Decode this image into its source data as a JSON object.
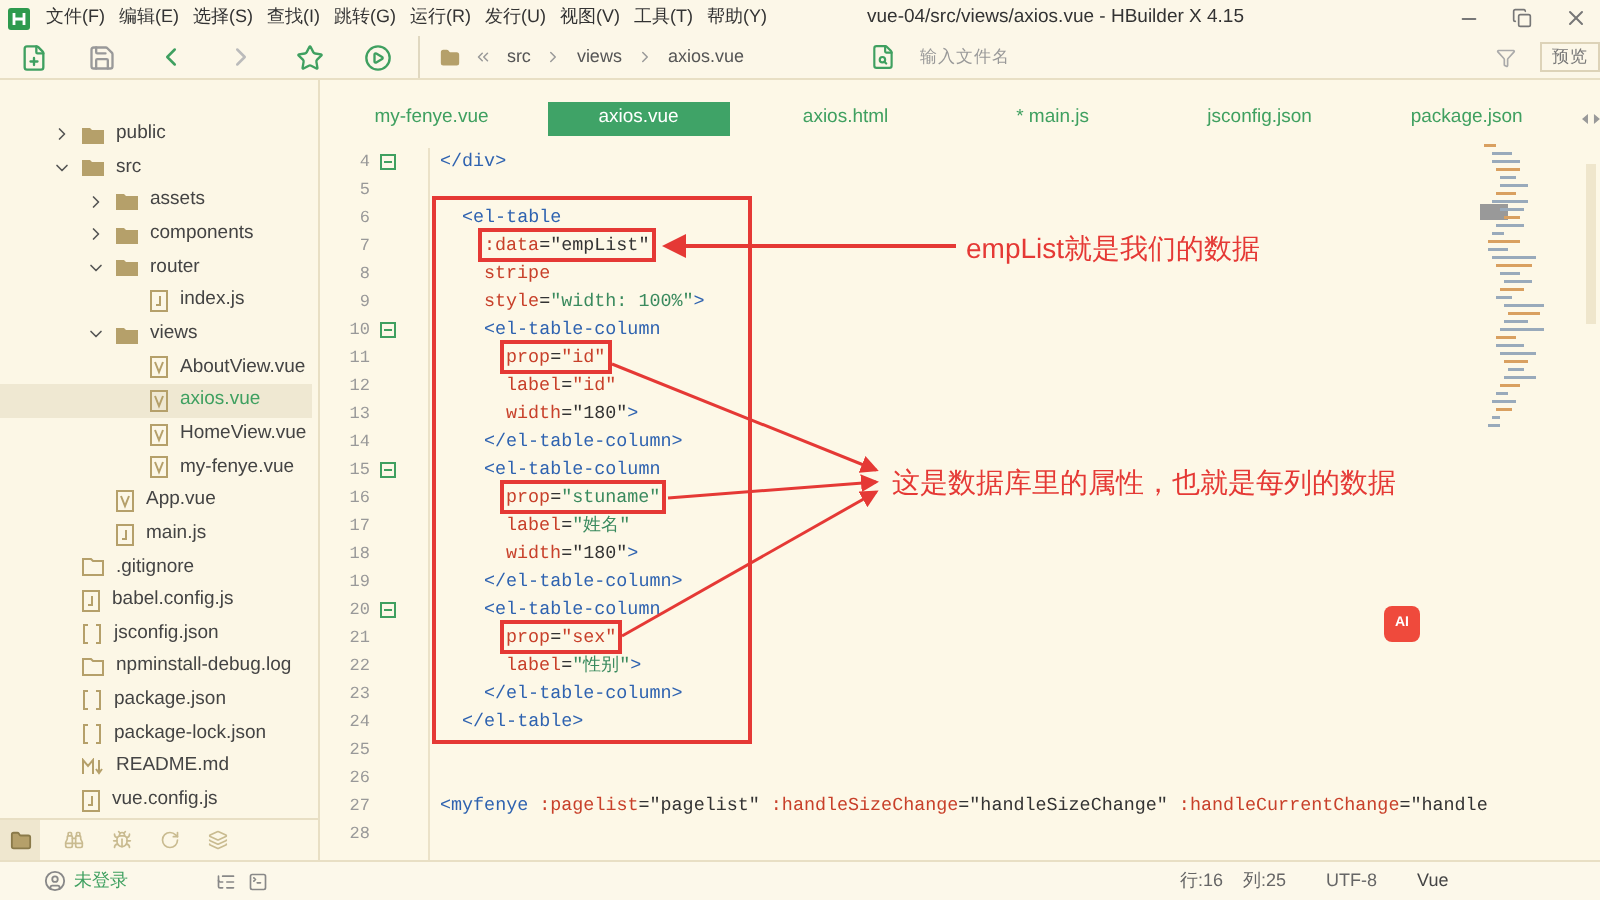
{
  "window": {
    "title": "vue-04/src/views/axios.vue - HBuilder X 4.15"
  },
  "menu": [
    "文件(F)",
    "编辑(E)",
    "选择(S)",
    "查找(I)",
    "跳转(G)",
    "运行(R)",
    "发行(U)",
    "视图(V)",
    "工具(T)",
    "帮助(Y)"
  ],
  "toolbar": {
    "breadcrumb": [
      "src",
      "views",
      "axios.vue"
    ],
    "search": {
      "placeholder": "输入文件名"
    },
    "preview_button": "预览"
  },
  "sidebar": {
    "tree": [
      {
        "name": "public",
        "kind": "folder",
        "expanded": false,
        "selected": false
      },
      {
        "name": "src",
        "kind": "folder",
        "expanded": true,
        "selected": false,
        "children": [
          {
            "name": "assets",
            "kind": "folder",
            "expanded": false,
            "selected": false
          },
          {
            "name": "components",
            "kind": "folder",
            "expanded": false,
            "selected": false
          },
          {
            "name": "router",
            "kind": "folder",
            "expanded": true,
            "selected": false,
            "children": [
              {
                "name": "index.js",
                "kind": "js",
                "selected": false
              }
            ]
          },
          {
            "name": "views",
            "kind": "folder",
            "expanded": true,
            "selected": false,
            "children": [
              {
                "name": "AboutView.vue",
                "kind": "vue",
                "selected": false
              },
              {
                "name": "axios.vue",
                "kind": "vue",
                "selected": true
              },
              {
                "name": "HomeView.vue",
                "kind": "vue",
                "selected": false
              },
              {
                "name": "my-fenye.vue",
                "kind": "vue",
                "selected": false
              }
            ]
          },
          {
            "name": "App.vue",
            "kind": "vue",
            "selected": false
          },
          {
            "name": "main.js",
            "kind": "js",
            "selected": false
          }
        ]
      },
      {
        "name": ".gitignore",
        "kind": "file",
        "selected": false
      },
      {
        "name": "babel.config.js",
        "kind": "js",
        "selected": false
      },
      {
        "name": "jsconfig.json",
        "kind": "json",
        "selected": false
      },
      {
        "name": "npminstall-debug.log",
        "kind": "file",
        "selected": false
      },
      {
        "name": "package.json",
        "kind": "json",
        "selected": false
      },
      {
        "name": "package-lock.json",
        "kind": "json",
        "selected": false
      },
      {
        "name": "README.md",
        "kind": "md",
        "selected": false
      },
      {
        "name": "vue.config.js",
        "kind": "js",
        "selected": false
      }
    ]
  },
  "tabs": [
    {
      "label": "my-fenye.vue",
      "selected": false
    },
    {
      "label": "axios.vue",
      "selected": true
    },
    {
      "label": "axios.html",
      "selected": false
    },
    {
      "label": "* main.js",
      "selected": false
    },
    {
      "label": "jsconfig.json",
      "selected": false
    },
    {
      "label": "package.json",
      "selected": false
    }
  ],
  "editor": {
    "blocks": [
      {
        "boxed": false,
        "lines": [
          {
            "number": "4",
            "foldable": true,
            "tokens": [
              {
                "kind": "tag",
                "text": "</div>"
              }
            ]
          },
          {
            "number": "5",
            "foldable": false
          }
        ]
      },
      {
        "boxed": true,
        "lines": [
          {
            "number": "6",
            "foldable": false,
            "tokens": [
              {
                "kind": "tag",
                "text": "<el-table"
              }
            ],
            "children": [
              {
                "number": "7",
                "foldable": false,
                "tokens": [
                  {
                    "kind": "boxed",
                    "tokens": [
                      {
                        "kind": "attr",
                        "text": ":data"
                      },
                      {
                        "kind": "plain",
                        "text": "=\"empList\""
                      }
                    ]
                  }
                ]
              },
              {
                "number": "8",
                "foldable": false,
                "tokens": [
                  {
                    "kind": "attr",
                    "text": "stripe"
                  }
                ]
              },
              {
                "number": "9",
                "foldable": false,
                "tokens": [
                  {
                    "kind": "attr",
                    "text": "style"
                  },
                  {
                    "kind": "plain",
                    "text": "="
                  },
                  {
                    "kind": "str",
                    "text": "\"width: 100%\""
                  },
                  {
                    "kind": "tag",
                    "text": ">"
                  }
                ]
              },
              {
                "number": "10",
                "foldable": true,
                "tokens": [
                  {
                    "kind": "tag",
                    "text": "<el-table-column"
                  }
                ],
                "children": [
                  {
                    "number": "11",
                    "foldable": false,
                    "tokens": [
                      {
                        "kind": "boxed",
                        "tokens": [
                          {
                            "kind": "attr",
                            "text": "prop"
                          },
                          {
                            "kind": "plain",
                            "text": "="
                          },
                          {
                            "kind": "attr",
                            "text": "\"id\""
                          }
                        ]
                      }
                    ]
                  },
                  {
                    "number": "12",
                    "foldable": false,
                    "tokens": [
                      {
                        "kind": "attr",
                        "text": "label"
                      },
                      {
                        "kind": "plain",
                        "text": "="
                      },
                      {
                        "kind": "attr",
                        "text": "\"id\""
                      }
                    ]
                  },
                  {
                    "number": "13",
                    "foldable": false,
                    "tokens": [
                      {
                        "kind": "attr",
                        "text": "width"
                      },
                      {
                        "kind": "plain",
                        "text": "=\"180\""
                      },
                      {
                        "kind": "tag",
                        "text": ">"
                      }
                    ]
                  }
                ]
              },
              {
                "number": "14",
                "foldable": false,
                "tokens": [
                  {
                    "kind": "tag",
                    "text": "</el-table-column>"
                  }
                ]
              },
              {
                "number": "15",
                "foldable": true,
                "tokens": [
                  {
                    "kind": "tag",
                    "text": "<el-table-column"
                  }
                ],
                "children": [
                  {
                    "number": "16",
                    "foldable": false,
                    "tokens": [
                      {
                        "kind": "boxed",
                        "tokens": [
                          {
                            "kind": "attr",
                            "text": "prop"
                          },
                          {
                            "kind": "plain",
                            "text": "="
                          },
                          {
                            "kind": "str",
                            "text": "\"stuname\""
                          }
                        ]
                      }
                    ]
                  },
                  {
                    "number": "17",
                    "foldable": false,
                    "tokens": [
                      {
                        "kind": "attr",
                        "text": "label"
                      },
                      {
                        "kind": "plain",
                        "text": "="
                      },
                      {
                        "kind": "str",
                        "text": "\"姓名\""
                      }
                    ]
                  },
                  {
                    "number": "18",
                    "foldable": false,
                    "tokens": [
                      {
                        "kind": "attr",
                        "text": "width"
                      },
                      {
                        "kind": "plain",
                        "text": "=\"180\""
                      },
                      {
                        "kind": "tag",
                        "text": ">"
                      }
                    ]
                  }
                ]
              },
              {
                "number": "19",
                "foldable": false,
                "tokens": [
                  {
                    "kind": "tag",
                    "text": "</el-table-column>"
                  }
                ]
              },
              {
                "number": "20",
                "foldable": true,
                "tokens": [
                  {
                    "kind": "tag",
                    "text": "<el-table-column"
                  }
                ],
                "children": [
                  {
                    "number": "21",
                    "foldable": false,
                    "tokens": [
                      {
                        "kind": "boxed",
                        "tokens": [
                          {
                            "kind": "attr",
                            "text": "prop"
                          },
                          {
                            "kind": "plain",
                            "text": "="
                          },
                          {
                            "kind": "attr",
                            "text": "\"sex\""
                          }
                        ]
                      }
                    ]
                  },
                  {
                    "number": "22",
                    "foldable": false,
                    "tokens": [
                      {
                        "kind": "attr",
                        "text": "label"
                      },
                      {
                        "kind": "plain",
                        "text": "="
                      },
                      {
                        "kind": "str",
                        "text": "\"性别\""
                      },
                      {
                        "kind": "tag",
                        "text": ">"
                      }
                    ]
                  }
                ]
              },
              {
                "number": "23",
                "foldable": false,
                "tokens": [
                  {
                    "kind": "tag",
                    "text": "</el-table-column>"
                  }
                ]
              }
            ]
          },
          {
            "number": "24",
            "foldable": false,
            "tokens": [
              {
                "kind": "tag",
                "text": "</el-table>"
              }
            ]
          }
        ]
      },
      {
        "boxed": false,
        "lines": [
          {
            "number": "25",
            "foldable": false
          },
          {
            "number": "26",
            "foldable": false
          },
          {
            "number": "27",
            "foldable": false,
            "tokens": [
              {
                "kind": "tag",
                "text": "<myfenye"
              },
              {
                "kind": "attr",
                "text": " :pagelist"
              },
              {
                "kind": "plain",
                "text": "=\"pagelist\""
              },
              {
                "kind": "attr",
                "text": " :handleSizeChange"
              },
              {
                "kind": "plain",
                "text": "=\"handleSizeChange\""
              },
              {
                "kind": "attr",
                "text": " :handleCurrentChange"
              },
              {
                "kind": "plain",
                "text": "=\"handle"
              }
            ]
          },
          {
            "number": "28",
            "foldable": false
          }
        ]
      }
    ],
    "annotations": [
      {
        "text": "empList就是我们的数据"
      },
      {
        "text": "这是数据库里的属性，也就是每列的数据"
      }
    ],
    "ai_button": "AI"
  },
  "status_bar": {
    "user": "未登录",
    "line": "行:16",
    "column": "列:25",
    "encoding": "UTF-8",
    "language": "Vue"
  }
}
